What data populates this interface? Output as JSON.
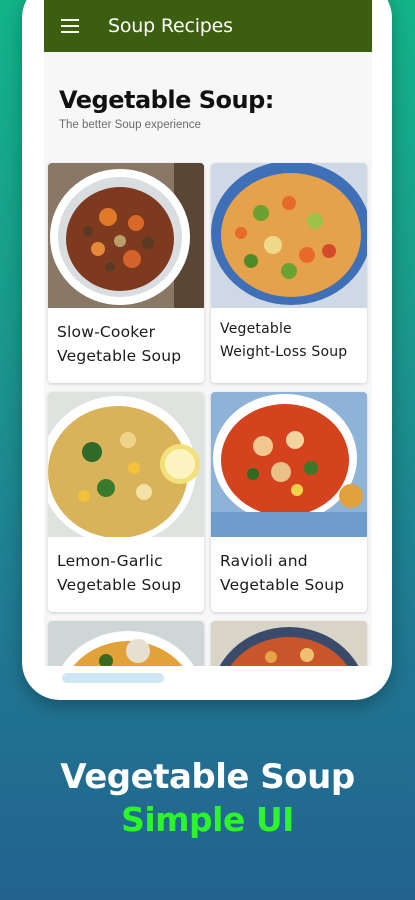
{
  "app": {
    "title": "Soup Recipes",
    "bar_color": "#3b5e0f"
  },
  "page": {
    "heading": "Vegetable Soup:",
    "subheading": "The better Soup experience"
  },
  "recipes": [
    {
      "line1": "Slow-Cooker",
      "line2": "Vegetable Soup",
      "image": "beef-vegetable-soup-photo"
    },
    {
      "line1": "Vegetable",
      "line2": "Weight-Loss Soup",
      "image": "vegetable-pot-photo"
    },
    {
      "line1": "Lemon-Garlic",
      "line2": "Vegetable Soup",
      "image": "lemon-chicken-soup-photo"
    },
    {
      "line1": "Ravioli and",
      "line2": "Vegetable Soup",
      "image": "ravioli-soup-photo"
    },
    {
      "line1": "",
      "line2": "",
      "image": "soup-bowl-photo"
    },
    {
      "line1": "",
      "line2": "",
      "image": "minestrone-photo"
    }
  ],
  "promo": {
    "title": "Vegetable Soup",
    "subtitle": "Simple UI",
    "title_color": "#ffffff",
    "subtitle_color": "#2cf52c"
  }
}
